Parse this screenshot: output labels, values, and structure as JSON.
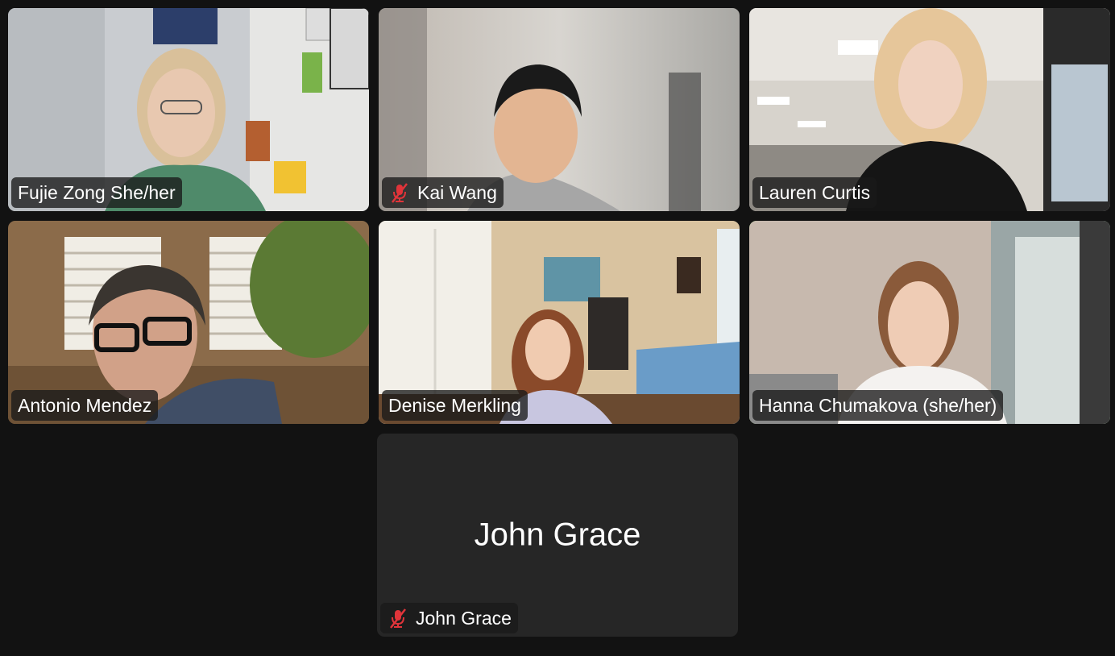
{
  "meeting": {
    "participants": [
      {
        "name": "Fujie Zong She/her",
        "muted": false,
        "speaking": false,
        "video": true
      },
      {
        "name": "Kai Wang",
        "muted": true,
        "speaking": false,
        "video": true
      },
      {
        "name": "Lauren Curtis",
        "muted": false,
        "speaking": false,
        "video": true
      },
      {
        "name": "Antonio Mendez",
        "muted": false,
        "speaking": false,
        "video": true
      },
      {
        "name": "Denise Merkling",
        "muted": false,
        "speaking": false,
        "video": true
      },
      {
        "name": "Hanna Chumakova (she/her)",
        "muted": false,
        "speaking": true,
        "video": true
      },
      {
        "name": "John Grace",
        "muted": true,
        "speaking": false,
        "video": false,
        "display_name": "John Grace"
      }
    ]
  },
  "colors": {
    "background": "#121212",
    "tile_empty": "#262626",
    "active_speaker_border": "#52d34e",
    "muted_icon": "#e0343a"
  },
  "icons": {
    "muted": "microphone-muted-icon"
  }
}
